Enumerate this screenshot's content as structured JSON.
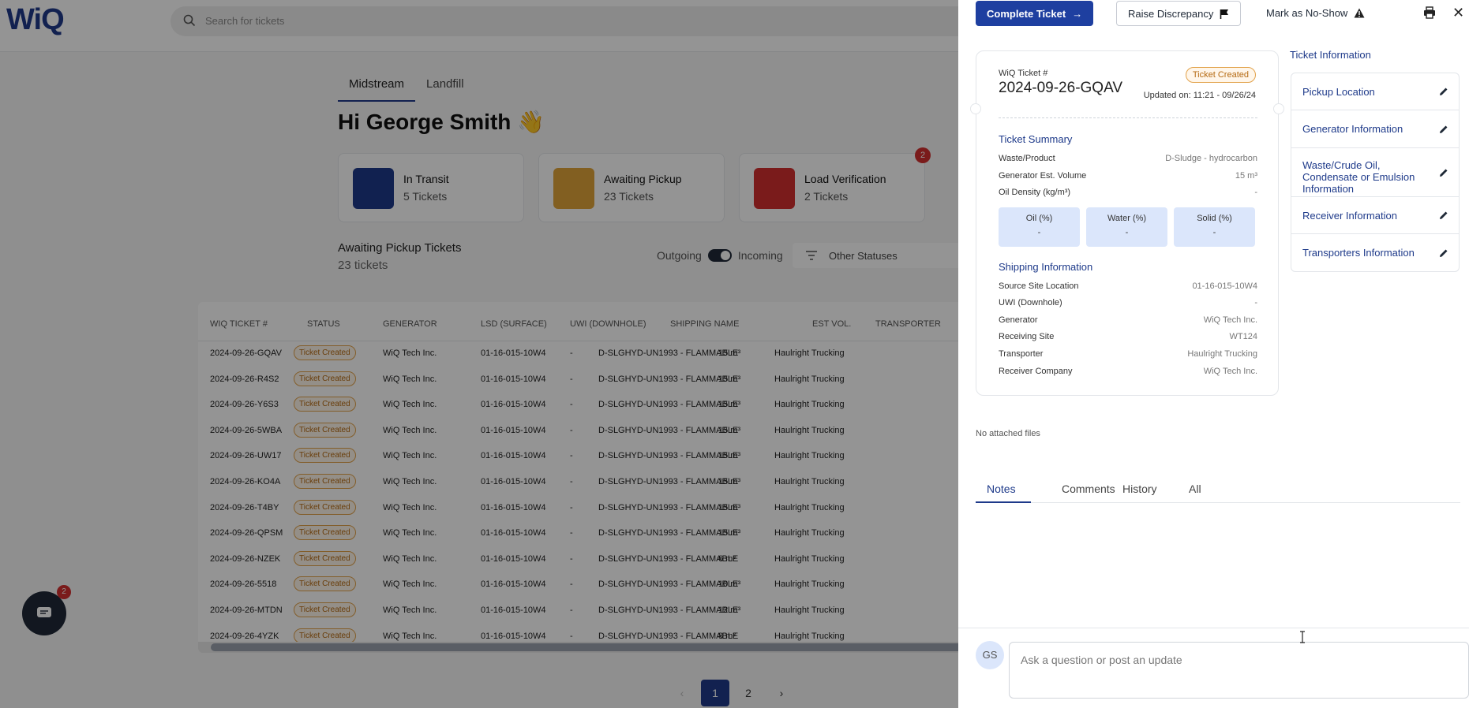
{
  "app": {
    "logo": "WiQ",
    "search_placeholder": "Search for tickets",
    "tabs": [
      "Midstream",
      "Landfill"
    ],
    "greeting": "Hi George Smith 👋",
    "stats": [
      {
        "title": "In Transit",
        "sub": "5 Tickets",
        "color": "#1e3a8a"
      },
      {
        "title": "Awaiting Pickup",
        "sub": "23 Tickets",
        "color": "#e0a43a"
      },
      {
        "title": "Load Verification",
        "sub": "2 Tickets",
        "color": "#d32f2f",
        "badge": "2"
      }
    ],
    "list_title": "Awaiting Pickup Tickets",
    "list_sub": "23 tickets",
    "toggle_left": "Outgoing",
    "toggle_right": "Incoming",
    "status_filter": "Other Statuses",
    "table": {
      "headers": [
        "WIQ TICKET #",
        "STATUS",
        "GENERATOR",
        "LSD (SURFACE)",
        "UWI (DOWNHOLE)",
        "SHIPPING NAME",
        "EST VOL.",
        "TRANSPORTER"
      ],
      "rows": [
        [
          "2024-09-26-GQAV",
          "Ticket Created",
          "WiQ Tech Inc.",
          "01-16-015-10W4",
          "-",
          "D-SLGHYD-UN1993 - FLAMMABLE",
          "15 m³",
          "Haulright Trucking"
        ],
        [
          "2024-09-26-R4S2",
          "Ticket Created",
          "WiQ Tech Inc.",
          "01-16-015-10W4",
          "-",
          "D-SLGHYD-UN1993 - FLAMMABLE",
          "15 m³",
          "Haulright Trucking"
        ],
        [
          "2024-09-26-Y6S3",
          "Ticket Created",
          "WiQ Tech Inc.",
          "01-16-015-10W4",
          "-",
          "D-SLGHYD-UN1993 - FLAMMABLE",
          "15 m³",
          "Haulright Trucking"
        ],
        [
          "2024-09-26-5WBA",
          "Ticket Created",
          "WiQ Tech Inc.",
          "01-16-015-10W4",
          "-",
          "D-SLGHYD-UN1993 - FLAMMABLE",
          "15 m³",
          "Haulright Trucking"
        ],
        [
          "2024-09-26-UW17",
          "Ticket Created",
          "WiQ Tech Inc.",
          "01-16-015-10W4",
          "-",
          "D-SLGHYD-UN1993 - FLAMMABLE",
          "15 m³",
          "Haulright Trucking"
        ],
        [
          "2024-09-26-KO4A",
          "Ticket Created",
          "WiQ Tech Inc.",
          "01-16-015-10W4",
          "-",
          "D-SLGHYD-UN1993 - FLAMMABLE",
          "15 m³",
          "Haulright Trucking"
        ],
        [
          "2024-09-26-T4BY",
          "Ticket Created",
          "WiQ Tech Inc.",
          "01-16-015-10W4",
          "-",
          "D-SLGHYD-UN1993 - FLAMMABLE",
          "15 m³",
          "Haulright Trucking"
        ],
        [
          "2024-09-26-QPSM",
          "Ticket Created",
          "WiQ Tech Inc.",
          "01-16-015-10W4",
          "-",
          "D-SLGHYD-UN1993 - FLAMMABLE",
          "15 m³",
          "Haulright Trucking"
        ],
        [
          "2024-09-26-NZEK",
          "Ticket Created",
          "WiQ Tech Inc.",
          "01-16-015-10W4",
          "-",
          "D-SLGHYD-UN1993 - FLAMMABLE",
          "6 m³",
          "Haulright Trucking"
        ],
        [
          "2024-09-26-5518",
          "Ticket Created",
          "WiQ Tech Inc.",
          "01-16-015-10W4",
          "-",
          "D-SLGHYD-UN1993 - FLAMMABLE",
          "10 m³",
          "Haulright Trucking"
        ],
        [
          "2024-09-26-MTDN",
          "Ticket Created",
          "WiQ Tech Inc.",
          "01-16-015-10W4",
          "-",
          "D-SLGHYD-UN1993 - FLAMMABLE",
          "12 m³",
          "Haulright Trucking"
        ],
        [
          "2024-09-26-4YZK",
          "Ticket Created",
          "WiQ Tech Inc.",
          "01-16-015-10W4",
          "-",
          "D-SLGHYD-UN1993 - FLAMMABLE",
          "8 m³",
          "Haulright Trucking"
        ]
      ]
    },
    "pager": {
      "prev": "‹",
      "pages": [
        "1",
        "2"
      ],
      "current": "1",
      "next": "›"
    },
    "chat_badge": "2"
  },
  "drawer": {
    "complete_label": "Complete Ticket",
    "discrepancy_label": "Raise Discrepancy",
    "noshow_label": "Mark as No-Show",
    "close_label": "✕",
    "card": {
      "label": "WiQ Ticket #",
      "ticket": "2024-09-26-GQAV",
      "status": "Ticket Created",
      "updated": "Updated on: 11:21 - 09/26/24",
      "summary_title": "Ticket Summary",
      "summary": [
        {
          "k": "Waste/Product",
          "v": "D-Sludge - hydrocarbon"
        },
        {
          "k": "Generator Est. Volume",
          "v": "15 m³"
        },
        {
          "k": "Oil Density (kg/m³)",
          "v": "-"
        }
      ],
      "percents": [
        {
          "label": "Oil (%)",
          "value": "-"
        },
        {
          "label": "Water (%)",
          "value": "-"
        },
        {
          "label": "Solid (%)",
          "value": "-"
        }
      ],
      "shipping_title": "Shipping Information",
      "shipping": [
        {
          "k": "Source Site Location",
          "v": "01-16-015-10W4"
        },
        {
          "k": "UWI (Downhole)",
          "v": "-"
        },
        {
          "k": "Generator",
          "v": "WiQ Tech Inc."
        },
        {
          "k": "Receiving Site",
          "v": "WT124"
        },
        {
          "k": "Transporter",
          "v": "Haulright Trucking"
        },
        {
          "k": "Receiver Company",
          "v": "WiQ Tech Inc."
        }
      ]
    },
    "info_title": "Ticket Information",
    "info_items": [
      "Pickup Location",
      "Generator Information",
      "Waste/Crude Oil, Condensate or Emulsion Information",
      "Receiver Information",
      "Transporters Information"
    ],
    "no_files": "No attached files",
    "note_tabs": [
      "Notes",
      "Comments",
      "History",
      "All"
    ],
    "avatar": "GS",
    "compose_placeholder": "Ask a question or post an update"
  }
}
